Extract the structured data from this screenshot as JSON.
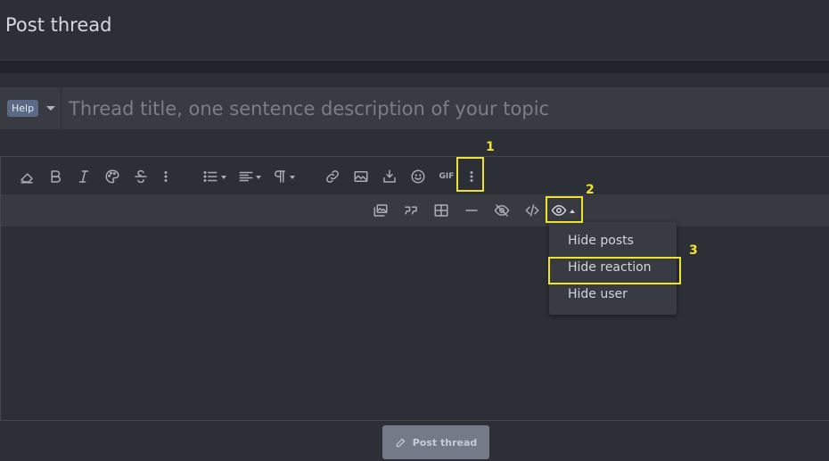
{
  "page": {
    "title": "Post thread"
  },
  "title_row": {
    "prefix": "Help",
    "placeholder": "Thread title, one sentence description of your topic"
  },
  "toolbar": {
    "gif_label": "GIF",
    "row1_icons": [
      "eraser-icon",
      "bold-icon",
      "italic-icon",
      "palette-icon",
      "strikethrough-icon",
      "more-text-icon",
      "list-icon",
      "align-icon",
      "paragraph-icon",
      "link-icon",
      "image-icon",
      "insert-icon",
      "smiley-icon",
      "gif-icon",
      "more-options-icon"
    ],
    "row2_icons": [
      "media-icon",
      "quote-icon",
      "table-icon",
      "horizontal-line-icon",
      "spoiler-icon",
      "code-icon",
      "hide-icon"
    ]
  },
  "hide_menu": {
    "items": [
      "Hide posts",
      "Hide reaction",
      "Hide user"
    ]
  },
  "annotations": {
    "label1": "1",
    "label2": "2",
    "label3": "3"
  },
  "submit": {
    "label": "Post thread"
  },
  "colors": {
    "highlight": "#f1e22b",
    "background": "#2d2f37",
    "toolbar_row2": "#383a42"
  }
}
